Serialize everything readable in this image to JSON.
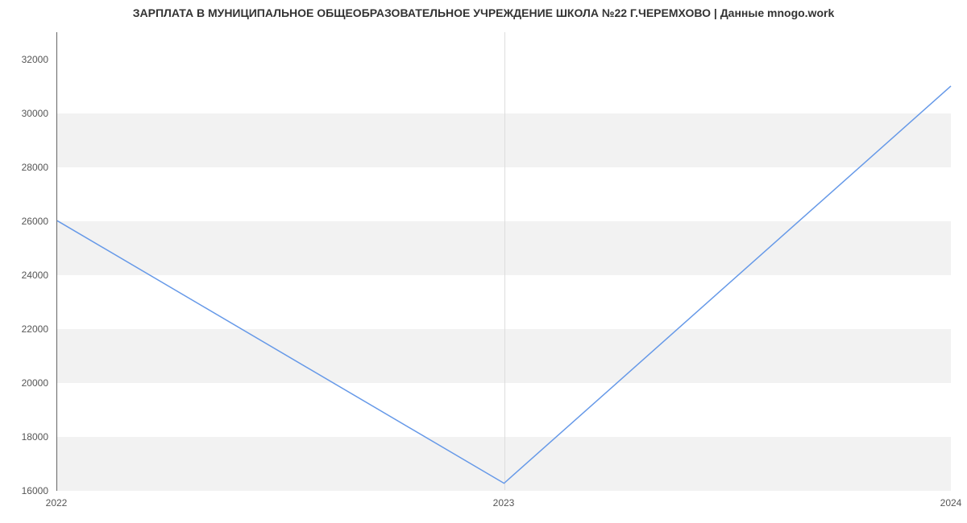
{
  "chart_data": {
    "type": "line",
    "title": "ЗАРПЛАТА В МУНИЦИПАЛЬНОЕ ОБЩЕОБРАЗОВАТЕЛЬНОЕ УЧРЕЖДЕНИЕ ШКОЛА №22 Г.ЧЕРЕМХОВО | Данные mnogo.work",
    "x": [
      2022,
      2023,
      2024
    ],
    "values": [
      26000,
      16250,
      31000
    ],
    "x_ticks": [
      2022,
      2023,
      2024
    ],
    "y_ticks": [
      16000,
      18000,
      20000,
      22000,
      24000,
      26000,
      28000,
      30000,
      32000
    ],
    "xlabel": "",
    "ylabel": "",
    "xlim": [
      2022,
      2024
    ],
    "ylim": [
      16000,
      33000
    ],
    "line_color": "#6699e8",
    "band_color": "#f2f2f2"
  }
}
